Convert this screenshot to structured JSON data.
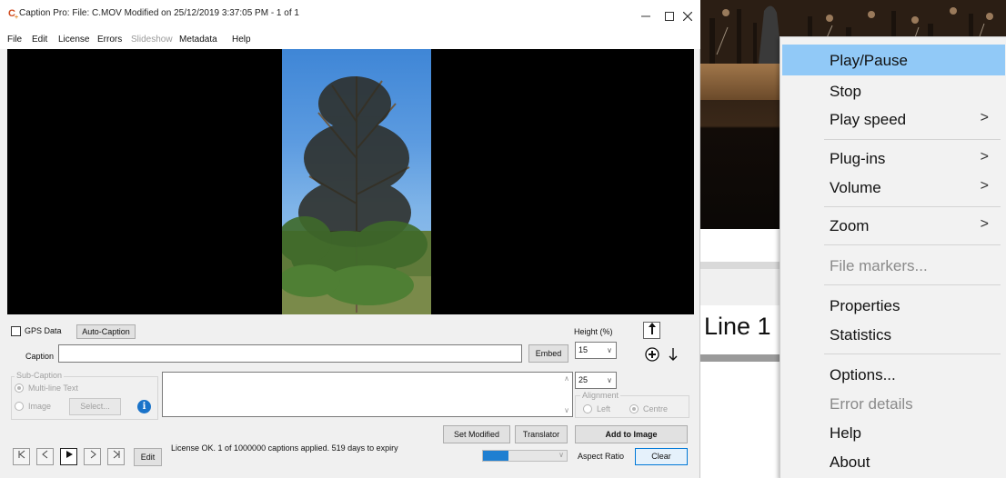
{
  "window": {
    "title": "Caption Pro: File: C.MOV Modified on 25/12/2019 3:37:05 PM - 1 of 1",
    "app_icon_text": "C",
    "app_icon_sub": "+",
    "minimize_icon": "minimize-icon",
    "maximize_icon": "maximize-icon",
    "close_icon": "close-icon"
  },
  "menu": [
    "File",
    "Edit",
    "License",
    "Errors",
    "Slideshow",
    "Metadata",
    "Help"
  ],
  "controls": {
    "gps_label": "GPS Data",
    "auto_caption": "Auto-Caption",
    "caption_label": "Caption",
    "caption_value": "",
    "embed": "Embed",
    "height_label": "Height (%)",
    "height_value": "15",
    "sub_caption_label": "Sub-Caption",
    "multiline_label": "Multi-line Text",
    "image_label": "Image",
    "select_label": "Select...",
    "subcaption_text": "",
    "size_value": "25",
    "alignment_label": "Alignment",
    "left_label": "Left",
    "centre_label": "Centre",
    "set_modified": "Set Modified",
    "translator": "Translator",
    "add_to_image": "Add to Image",
    "edit": "Edit",
    "status": "License OK. 1 of 1000000 captions applied. 519 days to expiry",
    "aspect_ratio": "Aspect Ratio",
    "clear": "Clear",
    "progress": 0.3
  },
  "background": {
    "caption_text": "Line 1"
  },
  "context_menu": {
    "items": [
      {
        "label": "Play/Pause",
        "highlighted": true,
        "submenu": false,
        "enabled": true
      },
      {
        "label": "Stop",
        "submenu": false,
        "enabled": true
      },
      {
        "label": "Play speed",
        "submenu": true,
        "enabled": true
      },
      {
        "label": "Plug-ins",
        "submenu": true,
        "enabled": true
      },
      {
        "label": "Volume",
        "submenu": true,
        "enabled": true
      },
      {
        "label": "Zoom",
        "submenu": true,
        "enabled": true
      },
      {
        "label": "File markers...",
        "submenu": false,
        "enabled": false
      },
      {
        "label": "Properties",
        "submenu": false,
        "enabled": true
      },
      {
        "label": "Statistics",
        "submenu": false,
        "enabled": true
      },
      {
        "label": "Options...",
        "submenu": false,
        "enabled": true
      },
      {
        "label": "Error details",
        "submenu": false,
        "enabled": false
      },
      {
        "label": "Help",
        "submenu": false,
        "enabled": true
      },
      {
        "label": "About",
        "submenu": false,
        "enabled": true
      }
    ],
    "submenu_arrow": ">"
  },
  "colors": {
    "menu_highlight": "#91c9f7",
    "info_blue": "#1a73c9",
    "progress_blue": "#1f7fd1"
  }
}
